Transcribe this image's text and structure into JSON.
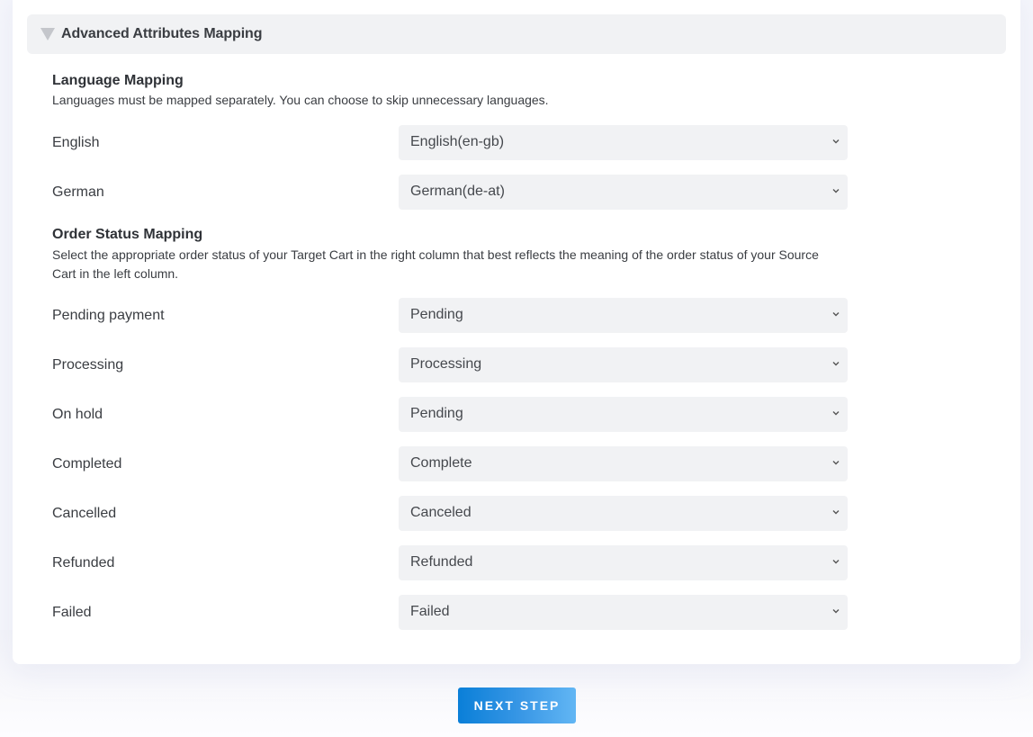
{
  "section": {
    "title": "Advanced Attributes Mapping",
    "expanded": true
  },
  "language_mapping": {
    "title": "Language Mapping",
    "description": "Languages must be mapped separately. You can choose to skip unnecessary languages.",
    "rows": [
      {
        "source": "English",
        "target": "English(en-gb)"
      },
      {
        "source": "German",
        "target": "German(de-at)"
      }
    ]
  },
  "order_status_mapping": {
    "title": "Order Status Mapping",
    "description_line1": "Select the appropriate order status of your Target Cart in the right column that best reflects the meaning of the order status of your Source",
    "description_line2": "Cart in the left column.",
    "rows": [
      {
        "source": "Pending payment",
        "target": "Pending"
      },
      {
        "source": "Processing",
        "target": "Processing"
      },
      {
        "source": "On hold",
        "target": "Pending"
      },
      {
        "source": "Completed",
        "target": "Complete"
      },
      {
        "source": "Cancelled",
        "target": "Canceled"
      },
      {
        "source": "Refunded",
        "target": "Refunded"
      },
      {
        "source": "Failed",
        "target": "Failed"
      }
    ]
  },
  "actions": {
    "next_step_label": "NEXT STEP"
  },
  "colors": {
    "accent_start": "#0a7fd8",
    "accent_end": "#62b6f4",
    "select_bg": "#f1f2f4",
    "page_bg": "#f5f6fb"
  }
}
